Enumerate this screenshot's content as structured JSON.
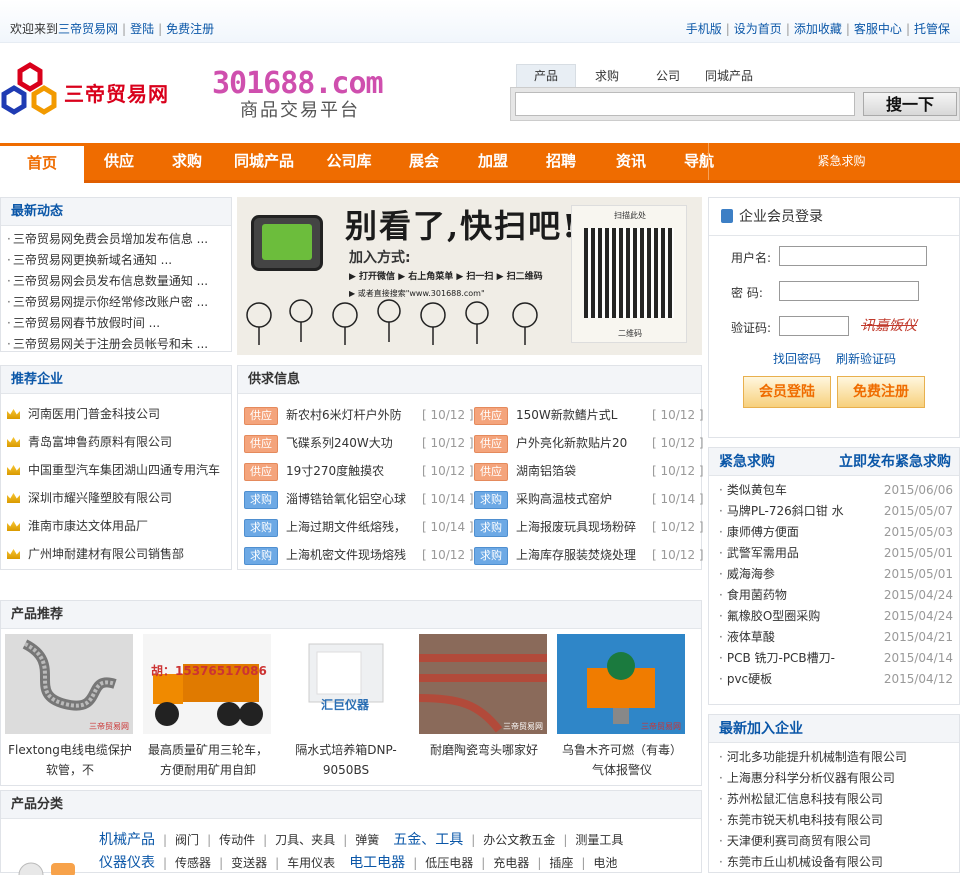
{
  "topbar": {
    "welcome": "欢迎来到",
    "site_name": "三帝贸易网",
    "login": "登陆",
    "register": "免费注册",
    "links": [
      "手机版",
      "设为首页",
      "添加收藏",
      "客服中心",
      "托管保"
    ]
  },
  "logo": {
    "text": "三帝贸易网",
    "domain": "301688.com",
    "slogan": "商品交易平台"
  },
  "search": {
    "tabs": [
      "产品",
      "求购",
      "公司",
      "同城产品"
    ],
    "active_tab": "产品",
    "placeholder": "",
    "button": "搜一下"
  },
  "nav": {
    "items": [
      "首页",
      "供应",
      "求购",
      "同城产品",
      "公司库",
      "展会",
      "加盟",
      "招聘",
      "资讯",
      "导航"
    ],
    "urgent": "紧急求购"
  },
  "news": {
    "title": "最新动态",
    "items": [
      "三帝贸易网免费会员增加发布信息 ...",
      "三帝贸易网更换新域名通知 ...",
      "三帝贸易网会员发布信息数量通知 ...",
      "三帝贸易网提示你经常修改账户密 ...",
      "三帝贸易网春节放假时间 ...",
      "三帝贸易网关于注册会员帐号和未 ..."
    ]
  },
  "banner": {
    "headline": "别看了,快扫吧!",
    "join": "加入方式:",
    "steps": "▶ 打开微信  ▶ 右上角菜单  ▶ 扫一扫  ▶ 扫二维码",
    "or": "▶ 或者直接搜索\"www.301688.com\"",
    "qr_top": "扫描此处",
    "qr_bottom": "二维码"
  },
  "login": {
    "title": "企业会员登录",
    "username_label": "用户名:",
    "password_label": "密   码:",
    "code_label": "验证码:",
    "captcha": "讯嘉饭仪",
    "forgot": "找回密码",
    "refresh": "刷新验证码",
    "login_btn": "会员登陆",
    "register_btn": "免费注册"
  },
  "recommend": {
    "title": "推荐企业",
    "items": [
      "河南医用门普金科技公司",
      "青岛富坤鲁药原料有限公司",
      "中国重型汽车集团湖山四通专用汽车",
      "深圳市耀兴隆塑胶有限公司",
      "淮南市康达文体用品厂",
      "广州坤耐建材有限公司销售部"
    ]
  },
  "supply": {
    "title": "供求信息",
    "left": [
      {
        "tag": "供应",
        "type": "g",
        "text": "新农村6米灯杆户外防",
        "date": "[ 10/12 ]"
      },
      {
        "tag": "供应",
        "type": "g",
        "text": "飞碟系列240W大功",
        "date": "[ 10/12 ]"
      },
      {
        "tag": "供应",
        "type": "g",
        "text": "19寸270度触摸农",
        "date": "[ 10/12 ]"
      },
      {
        "tag": "求购",
        "type": "q",
        "text": "淄博锆铪氧化铝空心球",
        "date": "[ 10/14 ]"
      },
      {
        "tag": "求购",
        "type": "q",
        "text": "上海过期文件纸熔残，",
        "date": "[ 10/14 ]"
      },
      {
        "tag": "求购",
        "type": "q",
        "text": "上海机密文件现场熔残",
        "date": "[ 10/12 ]"
      }
    ],
    "right": [
      {
        "tag": "供应",
        "type": "g",
        "text": "150W新款鳍片式L",
        "date": "[ 10/12 ]"
      },
      {
        "tag": "供应",
        "type": "g",
        "text": "户外亮化新款贴片20",
        "date": "[ 10/12 ]"
      },
      {
        "tag": "供应",
        "type": "g",
        "text": "湖南铝箔袋",
        "date": "[ 10/12 ]"
      },
      {
        "tag": "求购",
        "type": "q",
        "text": "采购高温枝式窑炉",
        "date": "[ 10/14 ]"
      },
      {
        "tag": "求购",
        "type": "q",
        "text": "上海报废玩具现场粉碎",
        "date": "[ 10/12 ]"
      },
      {
        "tag": "求购",
        "type": "q",
        "text": "上海库存服装焚烧处理",
        "date": "[ 10/12 ]"
      }
    ]
  },
  "urgent": {
    "title": "紧急求购",
    "publish": "立即发布紧急求购",
    "items": [
      {
        "name": "类似黄包车",
        "date": "2015/06/06"
      },
      {
        "name": "马牌PL-726斜口钳 水",
        "date": "2015/05/07"
      },
      {
        "name": "康师傅方便面",
        "date": "2015/05/03"
      },
      {
        "name": "武警军需用品",
        "date": "2015/05/01"
      },
      {
        "name": "威海海参",
        "date": "2015/05/01"
      },
      {
        "name": "食用菌药物",
        "date": "2015/04/24"
      },
      {
        "name": "氟橡胶O型圈采购",
        "date": "2015/04/24"
      },
      {
        "name": "液体草酸",
        "date": "2015/04/21"
      },
      {
        "name": "PCB 铣刀-PCB槽刀-",
        "date": "2015/04/14"
      },
      {
        "name": "pvc硬板",
        "date": "2015/04/12"
      }
    ]
  },
  "new_companies": {
    "title": "最新加入企业",
    "items": [
      "河北多功能提升机械制造有限公司",
      "上海惠分科学分析仪器有限公司",
      "苏州松鼠汇信息科技有限公司",
      "东莞市锐天机电科技有限公司",
      "天津便利赛司商贸有限公司",
      "东莞市丘山机械设备有限公司"
    ]
  },
  "products": {
    "title": "产品推荐",
    "items": [
      {
        "name": "Flextong电线电缆保护软管，不",
        "watermark": "三帝贸易网"
      },
      {
        "name": "最高质量矿用三轮车，方便耐用矿用自卸",
        "watermark": "胡：15376517086"
      },
      {
        "name": "隔水式培养箱DNP-9050BS",
        "watermark": "汇巨仪器"
      },
      {
        "name": "耐磨陶瓷弯头哪家好",
        "watermark": "三帝贸易网"
      },
      {
        "name": "乌鲁木齐可燃（有毒）气体报警仪",
        "watermark": "三帝贸易网"
      }
    ]
  },
  "categories": {
    "title": "产品分类",
    "row1": [
      {
        "head": "机械产品",
        "subs": [
          "阀门",
          "传动件",
          "刀具、夹具",
          "弹簧"
        ]
      },
      {
        "head": "五金、工具",
        "subs": [
          "办公文教五金",
          "测量工具"
        ]
      }
    ],
    "row2": [
      {
        "head": "仪器仪表",
        "subs": [
          "传感器",
          "变送器",
          "车用仪表"
        ]
      },
      {
        "head": "电工电器",
        "subs": [
          "低压电器",
          "充电器",
          "插座",
          "电池"
        ]
      }
    ]
  },
  "colors": {
    "accent": "#ef6c00",
    "link": "#0b57a8",
    "brand_red": "#d9001b"
  }
}
